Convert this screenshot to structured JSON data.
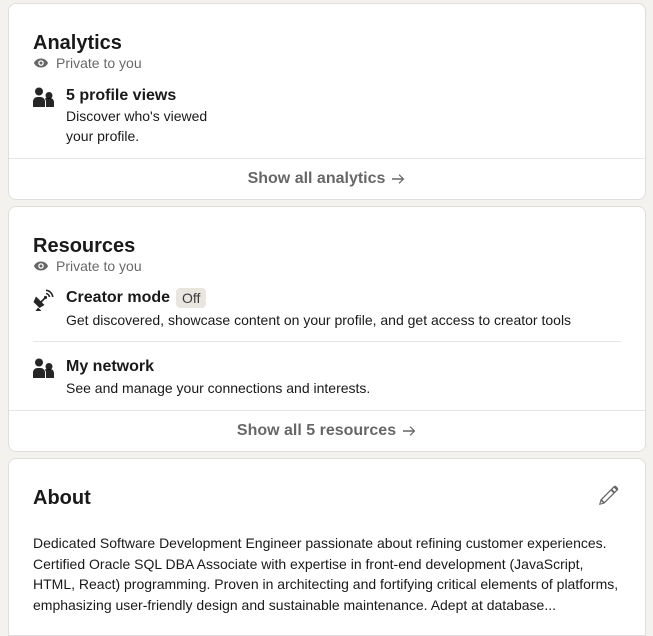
{
  "analytics": {
    "title": "Analytics",
    "privacy": "Private to you",
    "item": {
      "title": "5 profile views",
      "desc_line1": "Discover who's viewed",
      "desc_line2": "your profile."
    },
    "footer": "Show all analytics"
  },
  "resources": {
    "title": "Resources",
    "privacy": "Private to you",
    "items": [
      {
        "title": "Creator mode",
        "badge": "Off",
        "desc": "Get discovered, showcase content on your profile, and get access to creator tools",
        "icon": "broadcast-icon"
      },
      {
        "title": "My network",
        "desc": "See and manage your connections and interests.",
        "icon": "people-icon"
      }
    ],
    "footer": "Show all 5 resources"
  },
  "about": {
    "title": "About",
    "text": "Dedicated Software Development Engineer passionate about refining customer experiences. Certified Oracle SQL DBA Associate with expertise in front-end development (JavaScript, HTML, React) programming. Proven in architecting and fortifying critical elements of platforms, emphasizing user-friendly design and sustainable maintenance. Adept at database..."
  }
}
